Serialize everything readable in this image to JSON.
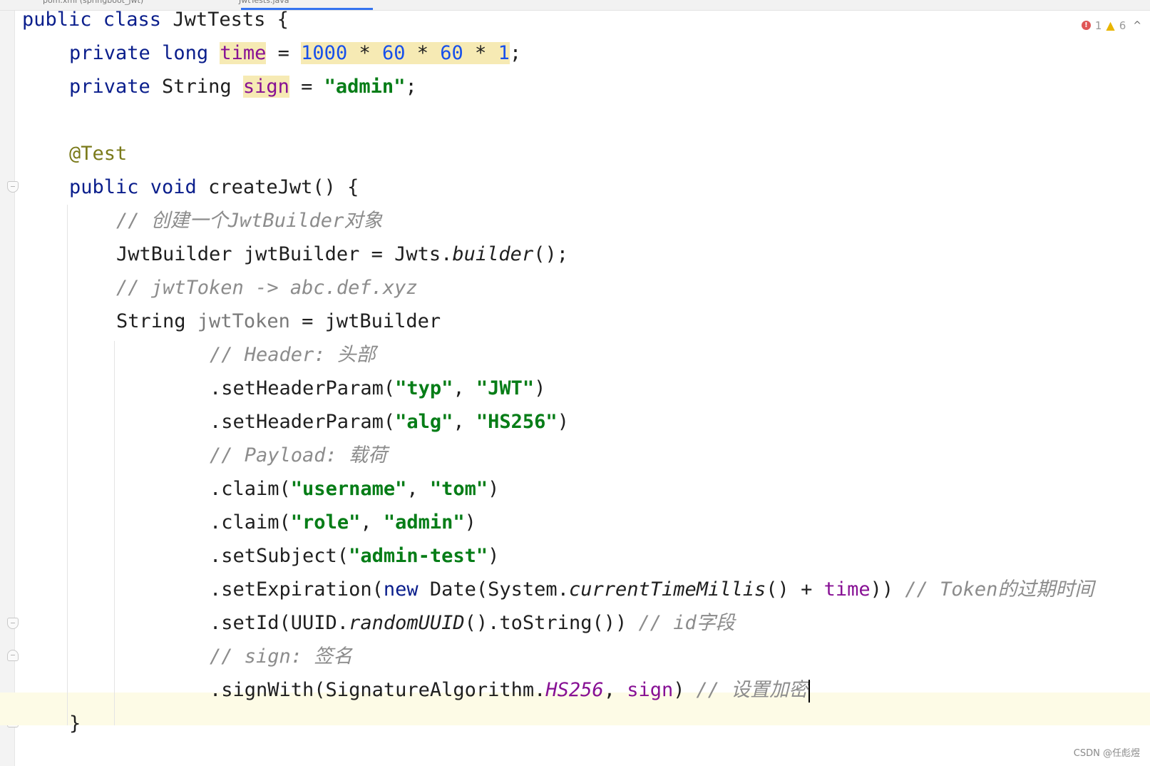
{
  "tabs": [
    {
      "label": "pom.xml (springboot_jwt)"
    },
    {
      "label": "JwtTests.java"
    }
  ],
  "inspections": {
    "errors": "1",
    "warnings": "6"
  },
  "code": {
    "line1": {
      "kw": "public class",
      "rest": " JwtTests {"
    },
    "line2": {
      "mod": "private",
      "type": "long",
      "name": "time",
      "eq": " = ",
      "n1": "1000",
      "op1": " * ",
      "n2": "60",
      "op2": " * ",
      "n3": "60",
      "op3": " * ",
      "n4": "1",
      "end": ";"
    },
    "line3": {
      "mod": "private",
      "type": " String ",
      "name": "sign",
      "eq": " = ",
      "val": "\"admin\"",
      "end": ";"
    },
    "line5": {
      "ann": "@Test"
    },
    "line6": {
      "kw": "public void",
      "rest": " createJwt() {"
    },
    "line7": {
      "cmt": "// 创建一个JwtBuilder对象"
    },
    "line8": {
      "pre": "JwtBuilder jwtBuilder = Jwts.",
      "method": "builder",
      "post": "();"
    },
    "line9": {
      "cmt": "// jwtToken -> abc.def.xyz"
    },
    "line10": {
      "pre": "String ",
      "var": "jwtToken",
      "post": " = jwtBuilder"
    },
    "line11": {
      "cmt": "// Header: 头部"
    },
    "line12": {
      "pre": ".setHeaderParam(",
      "s1": "\"typ\"",
      "mid": ", ",
      "s2": "\"JWT\"",
      "post": ")"
    },
    "line13": {
      "pre": ".setHeaderParam(",
      "s1": "\"alg\"",
      "mid": ", ",
      "s2": "\"HS256\"",
      "post": ")"
    },
    "line14": {
      "cmt": "// Payload: 载荷"
    },
    "line15": {
      "pre": ".claim(",
      "s1": "\"username\"",
      "mid": ", ",
      "s2": "\"tom\"",
      "post": ")"
    },
    "line16": {
      "pre": ".claim(",
      "s1": "\"role\"",
      "mid": ", ",
      "s2": "\"admin\"",
      "post": ")"
    },
    "line17": {
      "pre": ".setSubject(",
      "s1": "\"admin-test\"",
      "post": ")"
    },
    "line18": {
      "pre": ".setExpiration(",
      "kw": "new",
      "mid": " Date(System.",
      "method": "currentTimeMillis",
      "mid2": "() + ",
      "field": "time",
      "post": ")) ",
      "cmt": "// Token的过期时间"
    },
    "line19": {
      "pre": ".setId(UUID.",
      "method": "randomUUID",
      "post": "().toString()) ",
      "cmt": "// id字段"
    },
    "line20": {
      "cmt": "// sign: 签名"
    },
    "line21": {
      "pre": ".signWith(SignatureAlgorithm.",
      "constant": "HS256",
      "mid": ", ",
      "field": "sign",
      "post": ")",
      "cmt": "// 设置加密"
    },
    "line22": {
      "brace": "}"
    }
  },
  "watermark": "CSDN @任彪煜"
}
